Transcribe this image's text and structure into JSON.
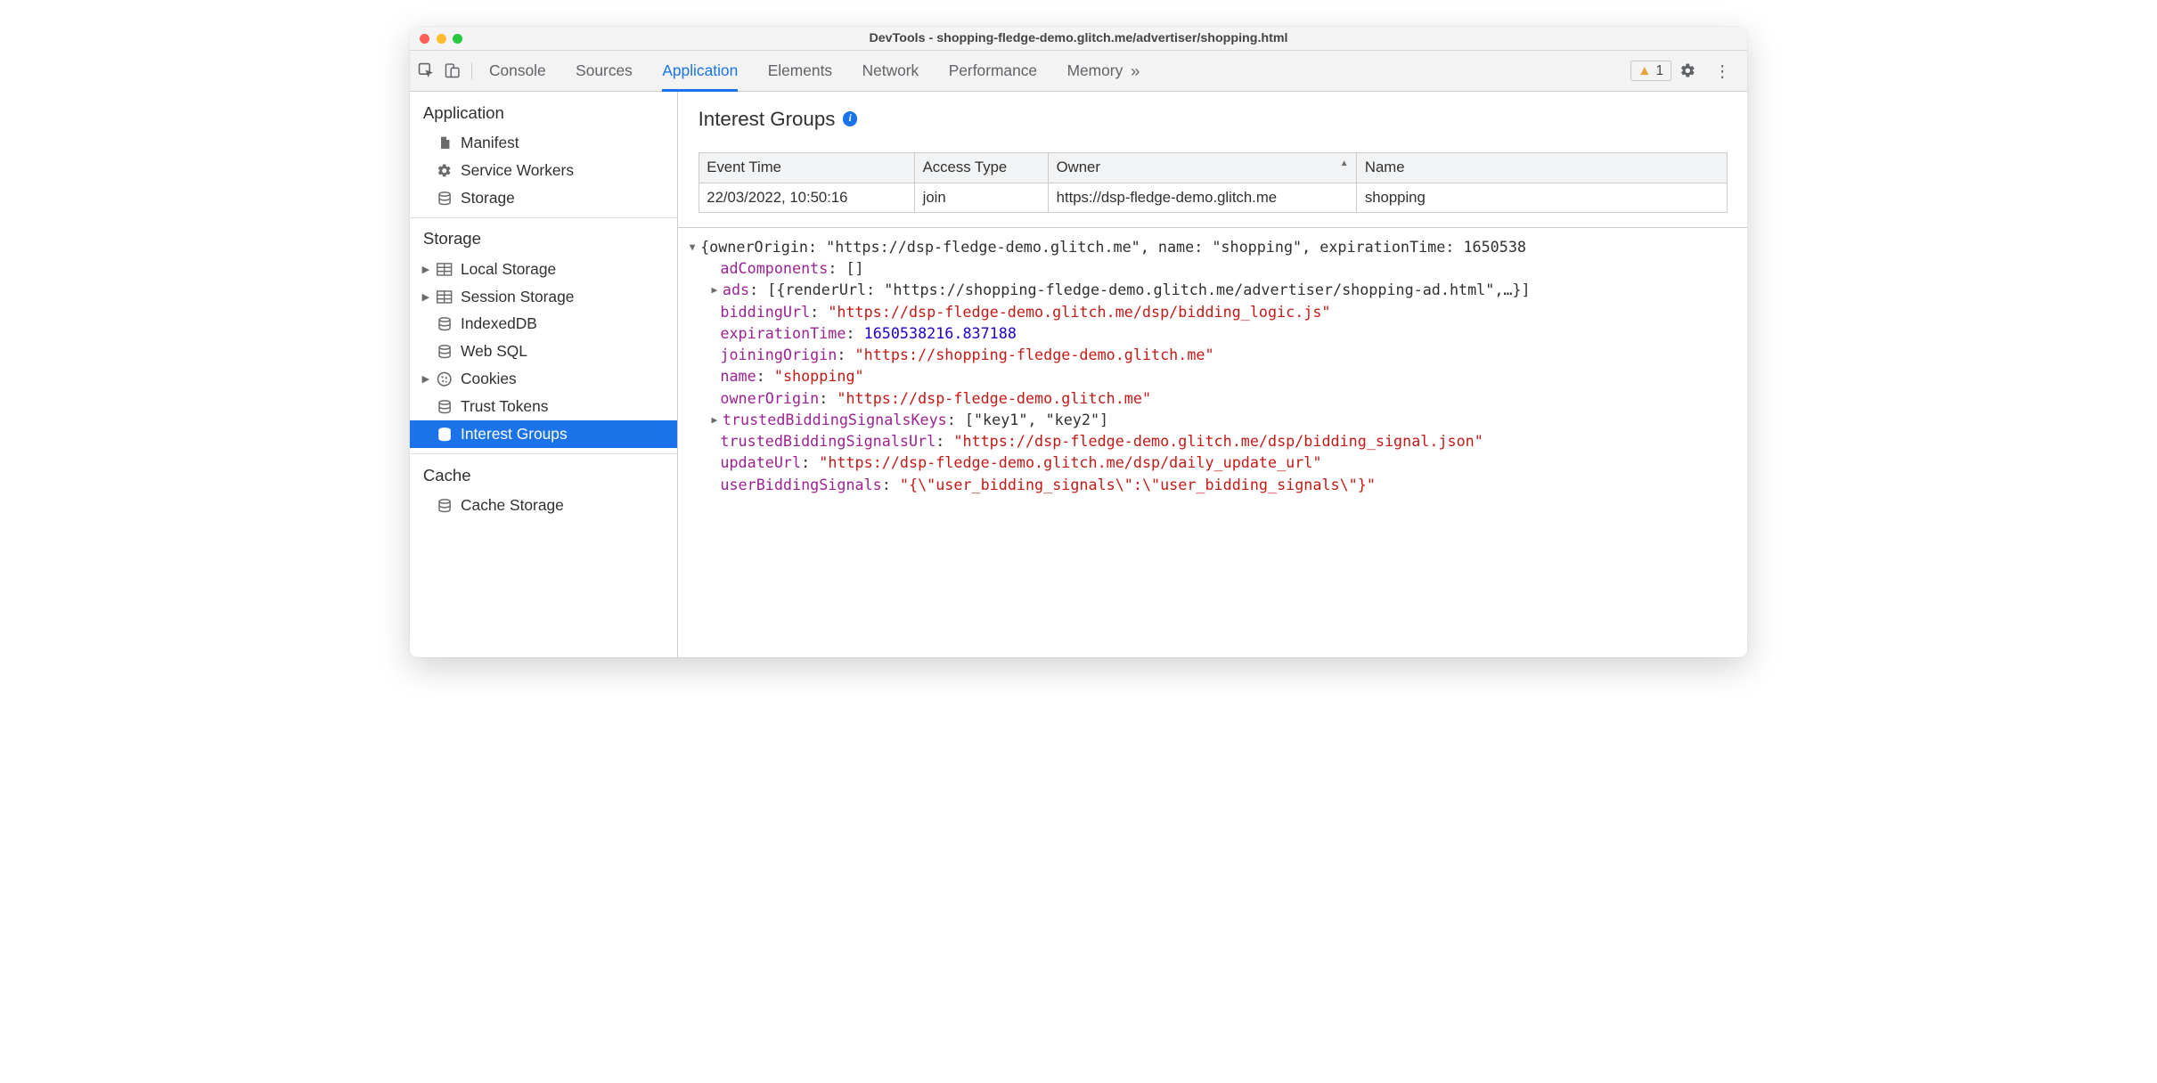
{
  "window": {
    "title": "DevTools - shopping-fledge-demo.glitch.me/advertiser/shopping.html"
  },
  "tabs": {
    "items": [
      "Console",
      "Sources",
      "Application",
      "Elements",
      "Network",
      "Performance",
      "Memory"
    ],
    "active": "Application",
    "issues_count": "1"
  },
  "sidebar": {
    "application": {
      "title": "Application",
      "items": [
        {
          "label": "Manifest",
          "icon": "manifest"
        },
        {
          "label": "Service Workers",
          "icon": "gear"
        },
        {
          "label": "Storage",
          "icon": "db"
        }
      ]
    },
    "storage": {
      "title": "Storage",
      "items": [
        {
          "label": "Local Storage",
          "icon": "table",
          "expandable": true
        },
        {
          "label": "Session Storage",
          "icon": "table",
          "expandable": true
        },
        {
          "label": "IndexedDB",
          "icon": "db"
        },
        {
          "label": "Web SQL",
          "icon": "db"
        },
        {
          "label": "Cookies",
          "icon": "cookie",
          "expandable": true
        },
        {
          "label": "Trust Tokens",
          "icon": "db"
        },
        {
          "label": "Interest Groups",
          "icon": "db",
          "selected": true
        }
      ]
    },
    "cache": {
      "title": "Cache",
      "items": [
        {
          "label": "Cache Storage",
          "icon": "db"
        }
      ]
    }
  },
  "panel": {
    "title": "Interest Groups",
    "table": {
      "headers": [
        "Event Time",
        "Access Type",
        "Owner",
        "Name"
      ],
      "sorted_col": 2,
      "rows": [
        [
          "22/03/2022, 10:50:16",
          "join",
          "https://dsp-fledge-demo.glitch.me",
          "shopping"
        ]
      ]
    },
    "details": {
      "summary_line": "{ownerOrigin: \"https://dsp-fledge-demo.glitch.me\", name: \"shopping\", expirationTime: 1650538",
      "adComponents_key": "adComponents",
      "adComponents_val": "[]",
      "ads_key": "ads",
      "ads_val": "[{renderUrl: \"https://shopping-fledge-demo.glitch.me/advertiser/shopping-ad.html\",…}]",
      "biddingUrl_key": "biddingUrl",
      "biddingUrl_val": "\"https://dsp-fledge-demo.glitch.me/dsp/bidding_logic.js\"",
      "expirationTime_key": "expirationTime",
      "expirationTime_val": "1650538216.837188",
      "joiningOrigin_key": "joiningOrigin",
      "joiningOrigin_val": "\"https://shopping-fledge-demo.glitch.me\"",
      "name_key": "name",
      "name_val": "\"shopping\"",
      "ownerOrigin_key": "ownerOrigin",
      "ownerOrigin_val": "\"https://dsp-fledge-demo.glitch.me\"",
      "trustedKeys_key": "trustedBiddingSignalsKeys",
      "trustedKeys_val": "[\"key1\", \"key2\"]",
      "trustedUrl_key": "trustedBiddingSignalsUrl",
      "trustedUrl_val": "\"https://dsp-fledge-demo.glitch.me/dsp/bidding_signal.json\"",
      "updateUrl_key": "updateUrl",
      "updateUrl_val": "\"https://dsp-fledge-demo.glitch.me/dsp/daily_update_url\"",
      "userBidding_key": "userBiddingSignals",
      "userBidding_val": "\"{\\\"user_bidding_signals\\\":\\\"user_bidding_signals\\\"}\""
    }
  }
}
